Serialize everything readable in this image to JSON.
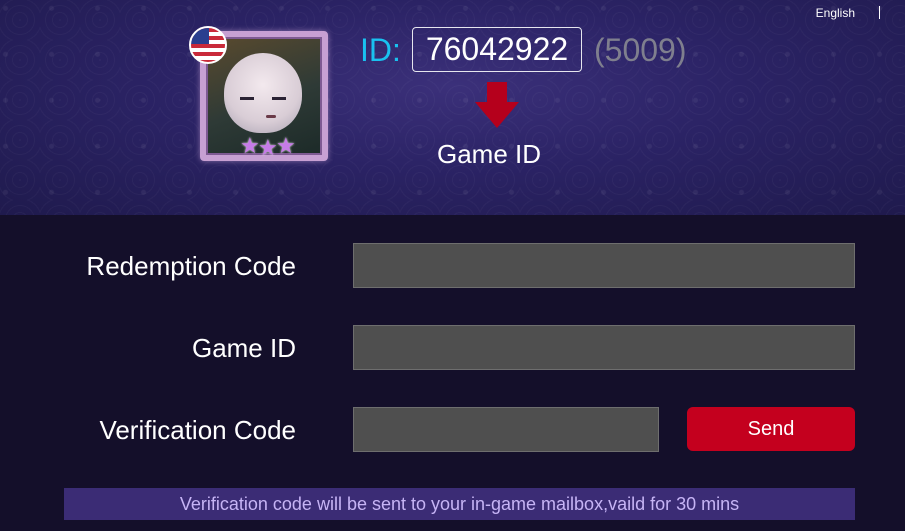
{
  "header": {
    "language": "English",
    "id_prefix": "ID:",
    "game_id_value": "76042922",
    "zone_id": "(5009)",
    "arrow_caption": "Game ID",
    "region_flag": "us-flag-icon",
    "avatar": "hero-avatar"
  },
  "form": {
    "redemption_code_label": "Redemption Code",
    "redemption_code_value": "",
    "game_id_label": "Game ID",
    "game_id_value": "",
    "verification_code_label": "Verification Code",
    "verification_code_value": "",
    "send_label": "Send",
    "notice": "Verification code will be sent to your in-game mailbox,vaild for 30 mins"
  },
  "colors": {
    "accent_cyan": "#19c1f0",
    "send_red": "#c4001e",
    "banner_purple": "#2b2365",
    "page_bg": "#140f2a",
    "notice_bg": "#3b2c75",
    "notice_text": "#c6b4f5"
  }
}
